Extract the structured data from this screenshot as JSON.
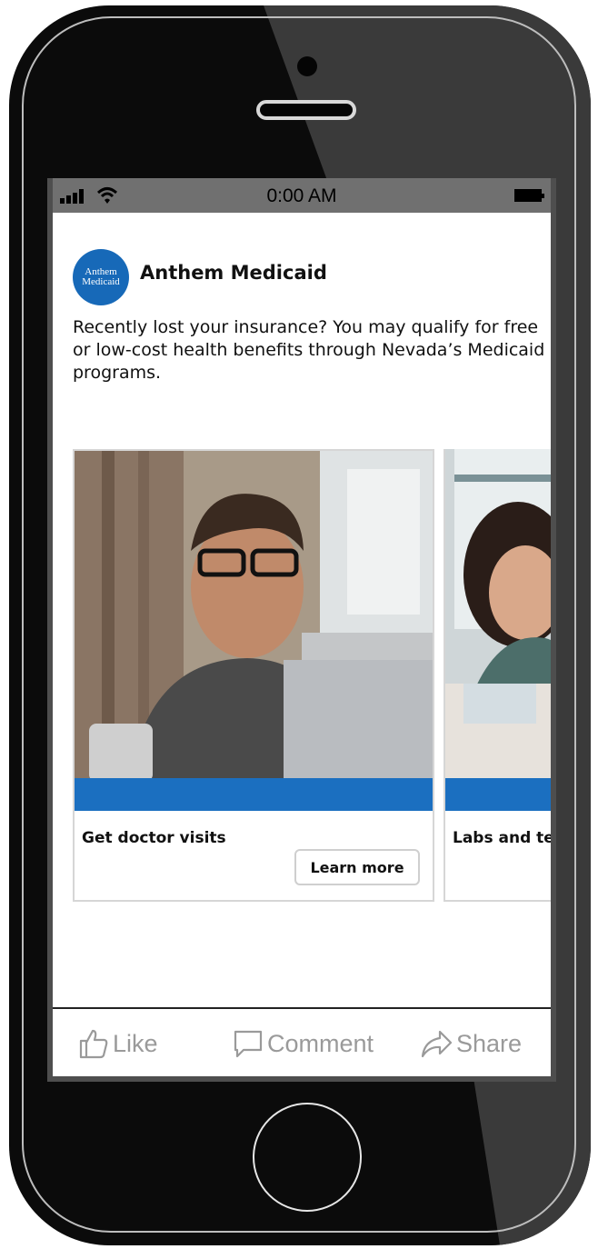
{
  "status_bar": {
    "time": "0:00 AM",
    "icons": [
      "signal-icon",
      "wifi-icon",
      "battery-icon"
    ]
  },
  "post": {
    "avatar_line1": "Anthem",
    "avatar_line2": "Medicaid",
    "page_name": "Anthem Medicaid",
    "text": "Recently lost your insurance? You may qualify for free or low-cost health benefits through Nevada’s Medicaid programs."
  },
  "carousel": {
    "cards": [
      {
        "title": "Get doctor visits",
        "button": "Learn more"
      },
      {
        "title": "Labs and tests"
      }
    ]
  },
  "actions": {
    "like": "Like",
    "comment": "Comment",
    "share": "Share"
  },
  "colors": {
    "brand_blue": "#1769b8",
    "band_blue": "#1b6fc0",
    "status_gray": "#707070"
  }
}
